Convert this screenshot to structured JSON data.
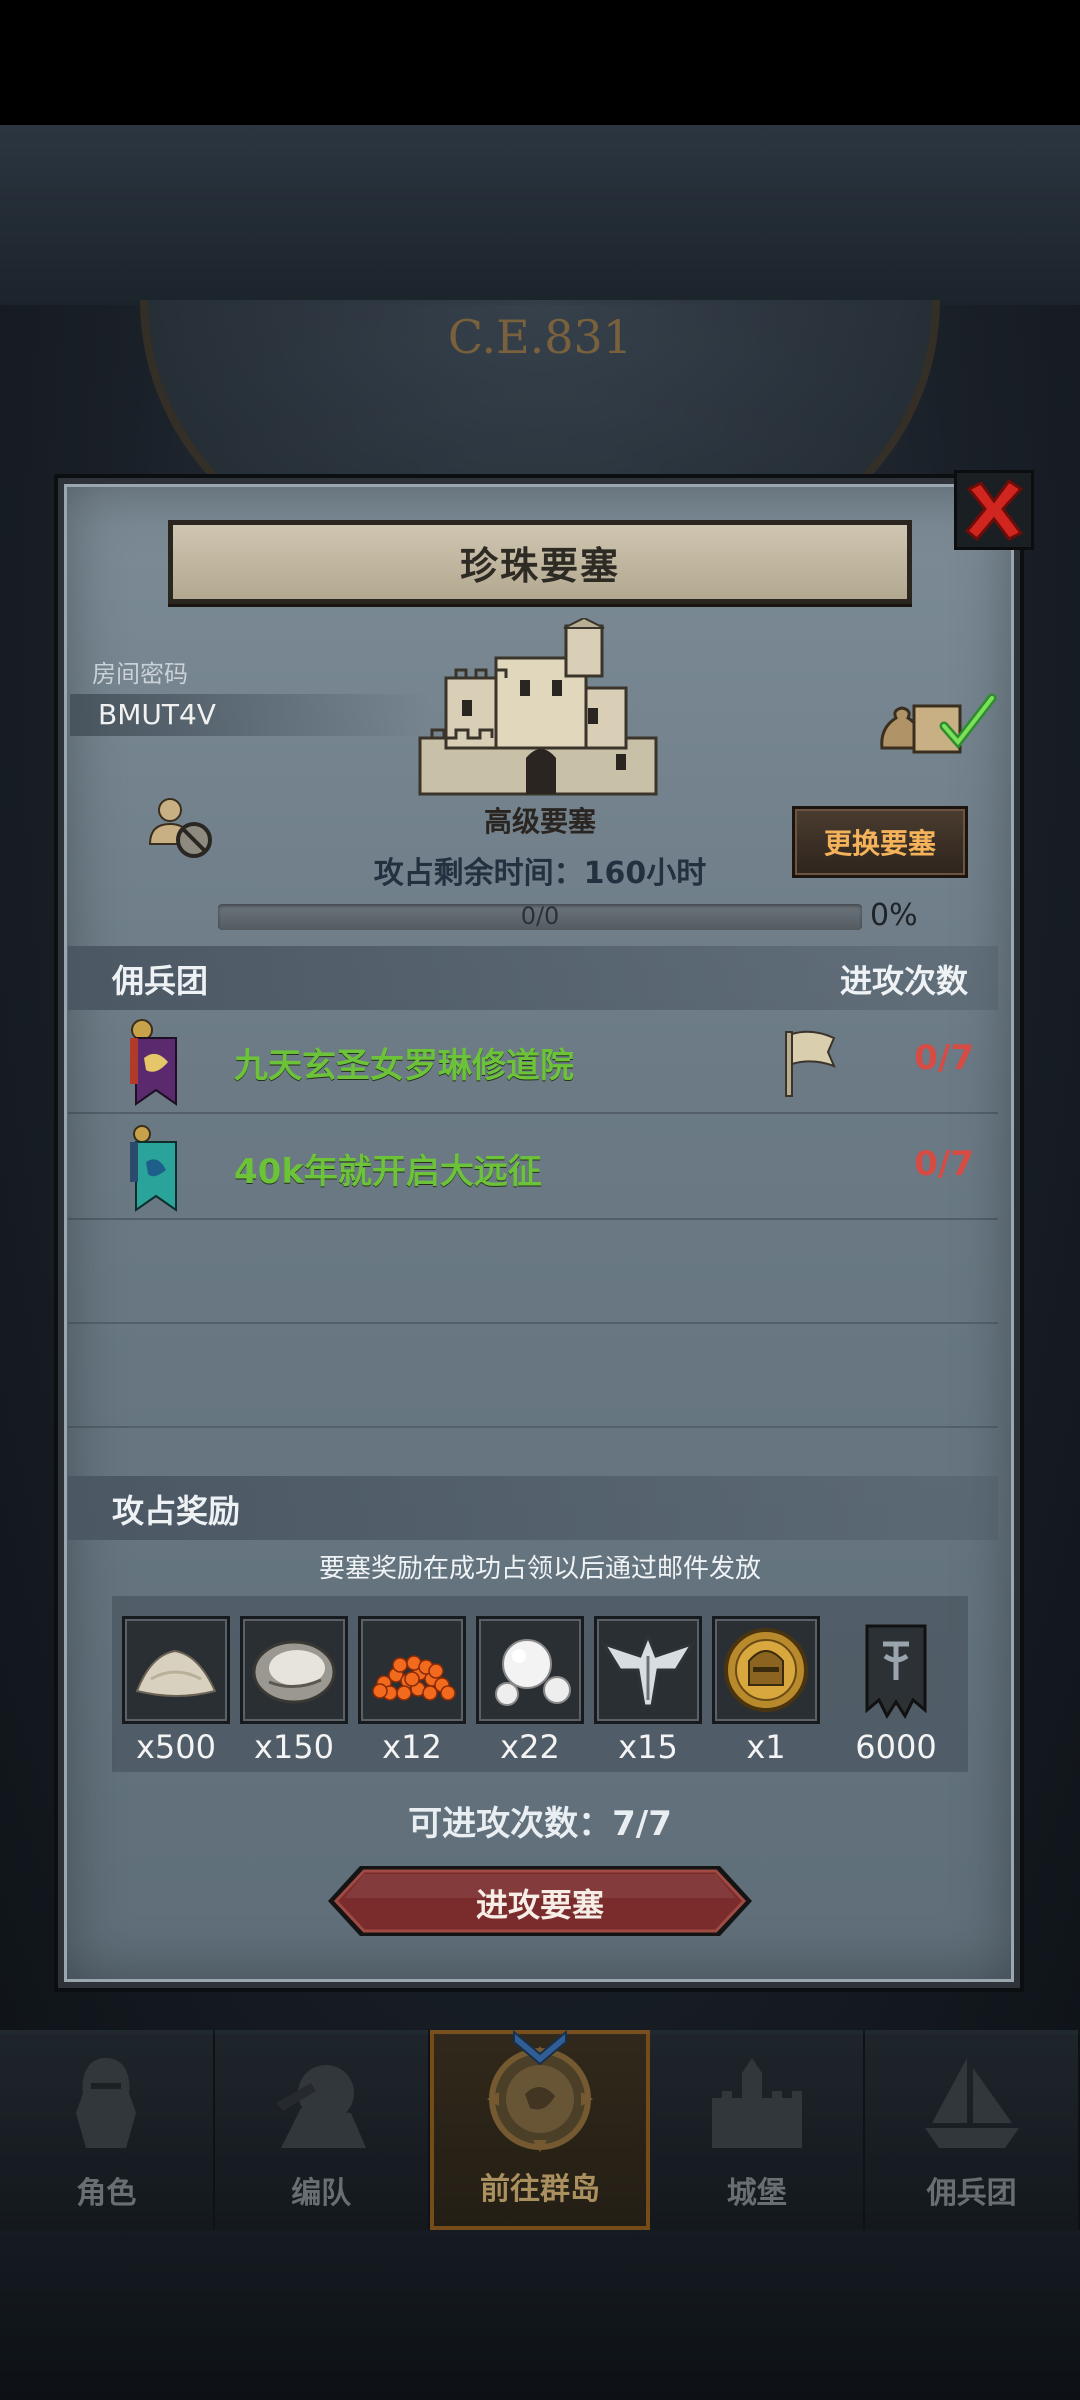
{
  "background": {
    "era_year": "C.E.831"
  },
  "dialog": {
    "title": "珍珠要塞",
    "room_code_label": "房间密码",
    "room_code": "BMUT4V",
    "fortress_grade": "高级要塞",
    "change_button": "更换要塞",
    "time_remaining": "攻占剩余时间：160小时",
    "progress": {
      "count_text": "0/0",
      "percent_text": "0%",
      "fraction": 0
    },
    "mercenary_header": "佣兵团",
    "attack_count_header": "进攻次数",
    "mercenaries": [
      {
        "name": "九天玄圣女罗琳修道院",
        "count": "0/7",
        "banner_color": "#5b2a6e",
        "has_flag": true
      },
      {
        "name": "40k年就开启大远征",
        "count": "0/7",
        "banner_color": "#2aa39a",
        "has_flag": false
      }
    ],
    "reward_header": "攻占奖励",
    "reward_note": "要塞奖励在成功占领以后通过邮件发放",
    "rewards": [
      {
        "icon": "flour-pile-icon",
        "qty": "x500"
      },
      {
        "icon": "oyster-icon",
        "qty": "x150"
      },
      {
        "icon": "fish-roe-icon",
        "qty": "x12"
      },
      {
        "icon": "pearl-icon",
        "qty": "x22"
      },
      {
        "icon": "winged-crest-icon",
        "qty": "x15"
      },
      {
        "icon": "gold-helmet-coin-icon",
        "qty": "x1"
      },
      {
        "icon": "guild-banner-icon",
        "qty": "6000"
      }
    ],
    "remaining_attacks": "可进攻次数：7/7",
    "attack_button": "进攻要塞"
  },
  "nav": {
    "items": [
      {
        "label": "角色",
        "icon": "knight-icon",
        "active": false
      },
      {
        "label": "编队",
        "icon": "formation-icon",
        "active": false
      },
      {
        "label": "前往群岛",
        "icon": "islands-icon",
        "active": true
      },
      {
        "label": "城堡",
        "icon": "castle-icon",
        "active": false
      },
      {
        "label": "佣兵团",
        "icon": "ship-icon",
        "active": false
      }
    ]
  },
  "colors": {
    "mercenary_name": "#6cc339",
    "attack_count": "#d64b43",
    "change_button_text": "#f4b35a",
    "attack_button": "#7a2b2b"
  }
}
